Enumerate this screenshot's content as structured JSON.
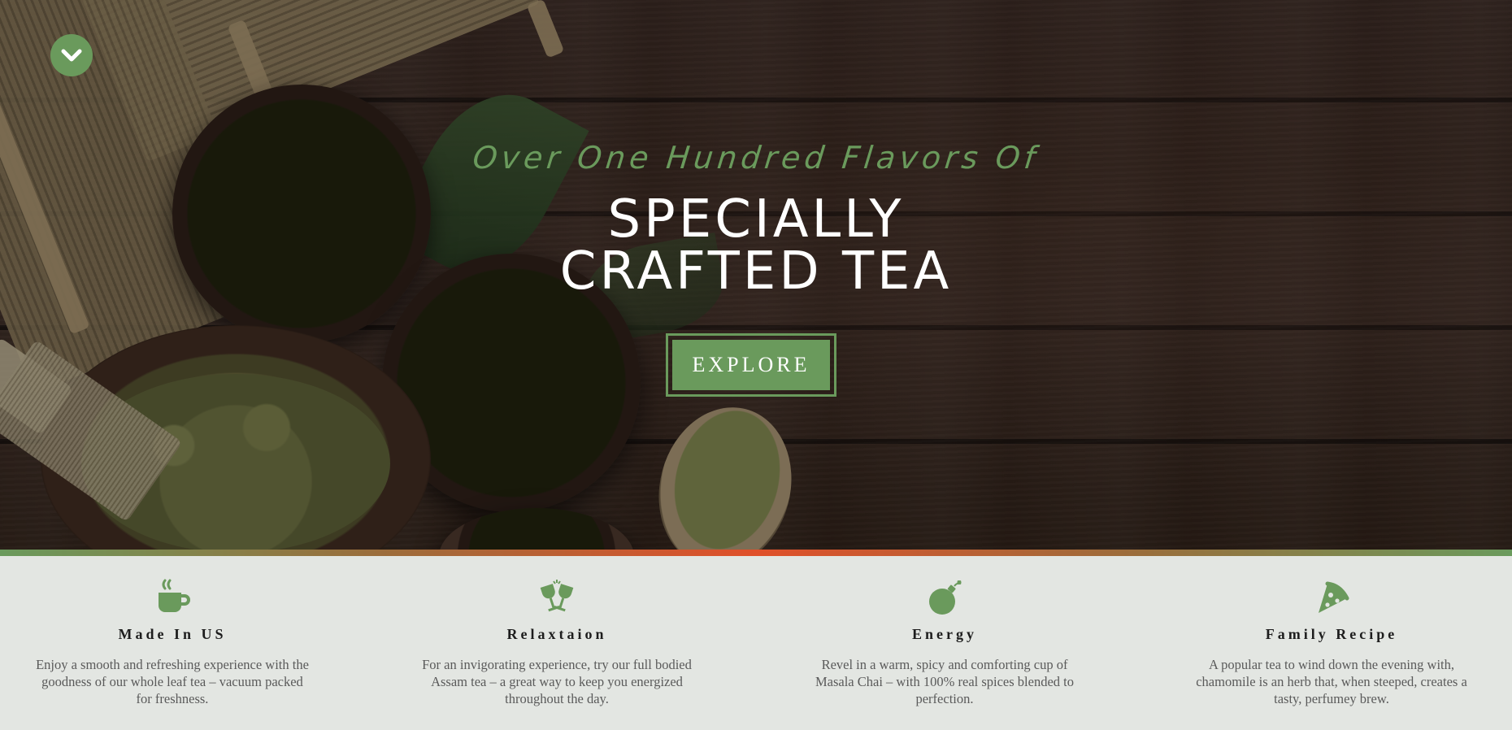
{
  "colors": {
    "accent": "#6a9a5c",
    "hero_text": "#ffffff",
    "feature_title": "#1d1d1d",
    "feature_text": "#5a5a5a",
    "section_background": "#e3e6e2",
    "divider_center": "#e0502a"
  },
  "header": {
    "menu_toggle_icon": "chevron-down-icon"
  },
  "hero": {
    "tagline": "Over One Hundred Flavors Of",
    "headline_line1": "SPECIALLY",
    "headline_line2": "CRAFTED TEA",
    "cta_label": "EXPLORE"
  },
  "features": [
    {
      "icon": "coffee-cup-icon",
      "title": "Made In US",
      "text": "Enjoy a smooth and refreshing experience with the goodness of our whole leaf tea – vacuum packed for freshness."
    },
    {
      "icon": "toasting-glasses-icon",
      "title": "Relaxtaion",
      "text": "For an invigorating experience, try our full bodied Assam tea – a great way to keep you energized throughout the day."
    },
    {
      "icon": "bomb-icon",
      "title": "Energy",
      "text": "Revel in a warm, spicy and comforting cup of Masala Chai – with 100% real spices blended to perfection."
    },
    {
      "icon": "pizza-slice-icon",
      "title": "Family Recipe",
      "text": "A popular tea to wind down the evening with, chamomile is an herb that, when steeped, creates a tasty, perfumey brew."
    }
  ]
}
